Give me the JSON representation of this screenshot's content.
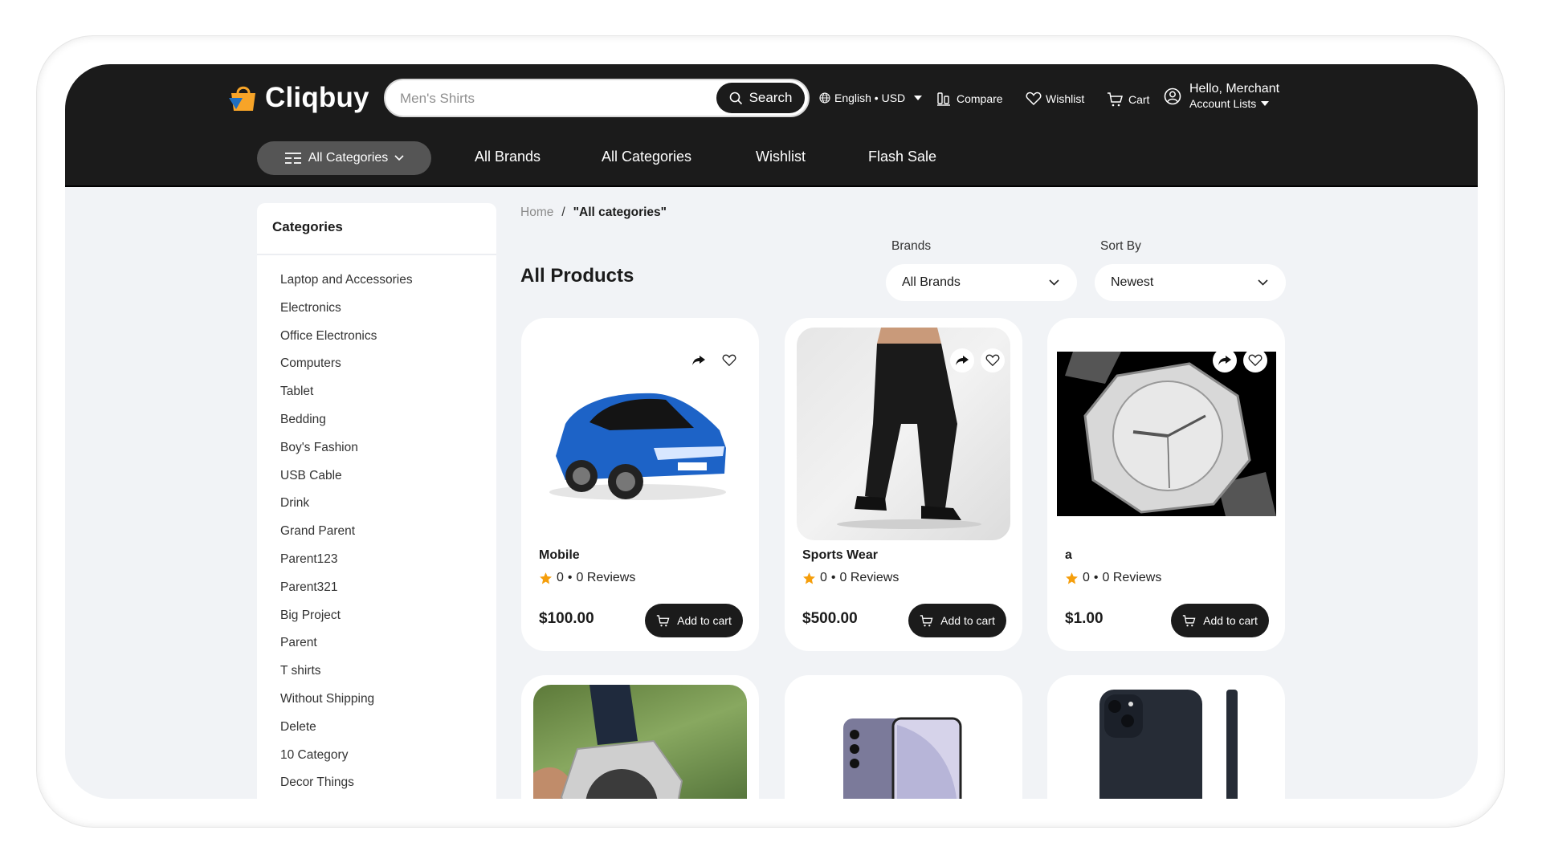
{
  "brand": {
    "name": "Cliqbuy"
  },
  "header": {
    "search_placeholder": "Men's Shirts",
    "search_button": "Search",
    "language_currency": "English • USD",
    "compare": "Compare",
    "wishlist": "Wishlist",
    "cart": "Cart",
    "greeting": "Hello, Merchant",
    "account_lists": "Account Lists"
  },
  "nav": {
    "all_categories_button": "All Categories",
    "links": [
      "All Brands",
      "All Categories",
      "Wishlist",
      "Flash Sale"
    ]
  },
  "sidebar": {
    "title": "Categories",
    "items": [
      "Laptop and Accessories",
      "Electronics",
      "Office Electronics",
      "Computers",
      "Tablet",
      "Bedding",
      "Boy's Fashion",
      "USB Cable",
      "Drink",
      "Grand Parent",
      "Parent123",
      "Parent321",
      "Big Project",
      "Parent",
      "T shirts",
      "Without Shipping",
      "Delete",
      "10 Category",
      "Decor Things"
    ]
  },
  "breadcrumb": {
    "home": "Home",
    "separator": "/",
    "current": "\"All categories\""
  },
  "main": {
    "title": "All Products",
    "brands_label": "Brands",
    "brands_value": "All Brands",
    "sort_label": "Sort By",
    "sort_value": "Newest"
  },
  "products": [
    {
      "name": "Mobile",
      "rating": "0",
      "reviews": "0 Reviews",
      "price": "$100.00",
      "cta": "Add to cart",
      "image": "blue-suv-car"
    },
    {
      "name": "Sports Wear",
      "rating": "0",
      "reviews": "0 Reviews",
      "price": "$500.00",
      "cta": "Add to cart",
      "image": "black-track-pants"
    },
    {
      "name": "a",
      "rating": "0",
      "reviews": "0 Reviews",
      "price": "$1.00",
      "cta": "Add to cart",
      "image": "silver-wristwatch"
    },
    {
      "image": "wristwatch-in-hand"
    },
    {
      "image": "purple-galaxy-s24-phone"
    },
    {
      "image": "black-iphone"
    }
  ],
  "colors": {
    "header_bg": "#1b1b1b",
    "page_bg": "#f1f3f6",
    "star": "#f59e0b",
    "logo_orange": "#f7a428",
    "logo_blue": "#1f6fc1"
  }
}
